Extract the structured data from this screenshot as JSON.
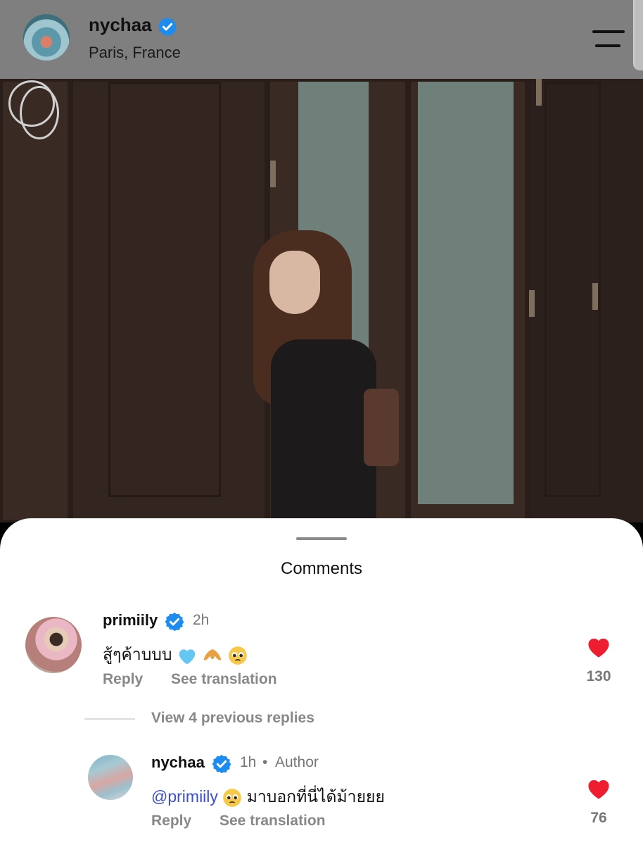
{
  "post": {
    "username": "nychaa",
    "location": "Paris, France"
  },
  "comments_sheet": {
    "title": "Comments",
    "view_replies": "View 4 previous replies"
  },
  "comments": [
    {
      "username": "primiily",
      "time": "2h",
      "text": "สู้ๆค้าบบบ",
      "emojis": [
        "light-blue-heart-icon",
        "croissant-icon",
        "pleading-face-icon"
      ],
      "reply_label": "Reply",
      "translate_label": "See translation",
      "likes": "130"
    },
    {
      "username": "nychaa",
      "time": "1h",
      "author_label": "Author",
      "mention": "@primiily",
      "text": "มาบอกที่นี่ได้ม้ายยย",
      "emojis": [
        "pleading-face-icon"
      ],
      "reply_label": "Reply",
      "translate_label": "See translation",
      "likes": "76"
    }
  ],
  "colors": {
    "verified_blue": "#1d8cf0",
    "heart_red": "#ee1d2f",
    "mention_blue": "#3b4fd1"
  }
}
